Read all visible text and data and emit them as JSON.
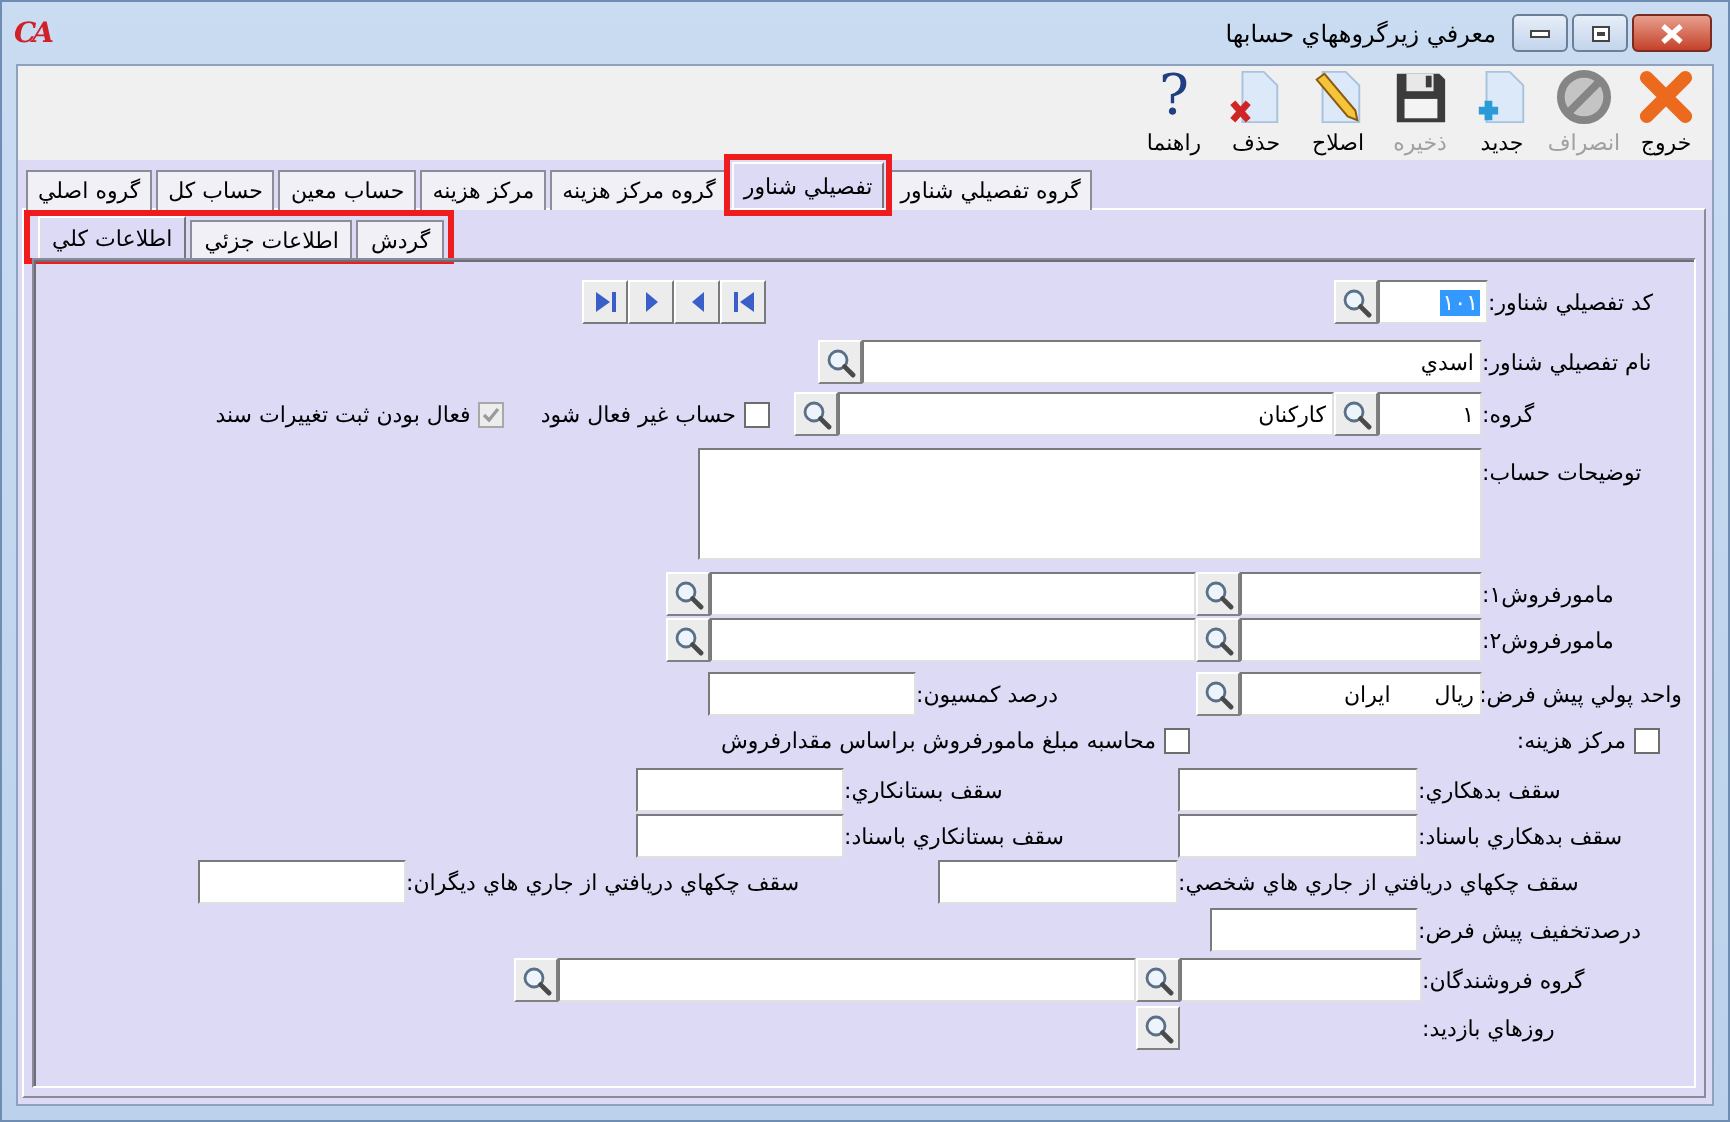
{
  "window": {
    "logo": "CA",
    "title": "معرفي زيرگروههاي حسابها"
  },
  "toolbar": [
    {
      "kind": "exit",
      "label": "خروج",
      "disabled": false
    },
    {
      "kind": "cancel",
      "label": "انصراف",
      "disabled": true
    },
    {
      "kind": "new",
      "label": "جديد",
      "disabled": false
    },
    {
      "kind": "save",
      "label": "ذخيره",
      "disabled": true
    },
    {
      "kind": "edit",
      "label": "اصلاح",
      "disabled": false
    },
    {
      "kind": "delete",
      "label": "حذف",
      "disabled": false
    },
    {
      "kind": "help",
      "label": "راهنما",
      "glyph": "?",
      "disabled": false
    }
  ],
  "tabs": [
    {
      "label": "گروه تفصيلي شناور",
      "selected": false,
      "highlighted": false
    },
    {
      "label": "تفصيلي شناور",
      "selected": true,
      "highlighted": true
    },
    {
      "label": "گروه مركز هزينه",
      "selected": false,
      "highlighted": false
    },
    {
      "label": "مركز هزينه",
      "selected": false,
      "highlighted": false
    },
    {
      "label": "حساب معين",
      "selected": false,
      "highlighted": false
    },
    {
      "label": "حساب كل",
      "selected": false,
      "highlighted": false
    },
    {
      "label": "گروه اصلي",
      "selected": false,
      "highlighted": false
    }
  ],
  "subtabs": {
    "highlighted": true,
    "items": [
      {
        "label": "گردش",
        "selected": false
      },
      {
        "label": "اطلاعات جزئي",
        "selected": false
      },
      {
        "label": "اطلاعات كلي",
        "selected": true
      }
    ]
  },
  "form": {
    "code": {
      "label": "كد تفصيلي شناور:",
      "value": "۱۰۱",
      "value_selected": true
    },
    "name": {
      "label": "نام تفصيلي شناور:",
      "value": "اسدي"
    },
    "group": {
      "label": "گروه:",
      "code": "۱",
      "name": "كاركنان"
    },
    "inactive": {
      "label": "حساب غير فعال شود",
      "checked": false,
      "disabled": false
    },
    "log_changes": {
      "label": "فعال بودن ثبت تغييرات سند",
      "checked": true,
      "disabled": true
    },
    "description": {
      "label": "توضيحات حساب:"
    },
    "salesperson_1": {
      "label": "مامورفروش۱:"
    },
    "salesperson_2": {
      "label": "مامورفروش۲:"
    },
    "currency": {
      "label": "واحد پولي پيش فرض:",
      "code": "ريال",
      "name": "ايران"
    },
    "commission": {
      "label": "درصد كمسيون:"
    },
    "cost_center": {
      "label": "مركز هزينه:",
      "checked": false,
      "disabled": false
    },
    "calc_by_quantity": {
      "label": "محاسبه مبلغ مامورفروش براساس مقدارفروش",
      "checked": false,
      "disabled": false
    },
    "debit_limit": {
      "label": "سقف بدهكاري:"
    },
    "credit_limit": {
      "label": "سقف بستانكاري:"
    },
    "debit_limit_docs": {
      "label": "سقف بدهكاري باسناد:"
    },
    "credit_limit_docs": {
      "label": "سقف بستانكاري باسناد:"
    },
    "cheque_limit_own": {
      "label": "سقف چكهاي دريافتي از جاري هاي شخصي:"
    },
    "cheque_limit_others": {
      "label": "سقف چكهاي دريافتي از جاري هاي ديگران:"
    },
    "default_discount": {
      "label": "درصدتخفيف پيش فرض:"
    },
    "seller_group": {
      "label": "گروه فروشندگان:"
    },
    "visit_days": {
      "label": "روزهاي بازديد:"
    }
  }
}
